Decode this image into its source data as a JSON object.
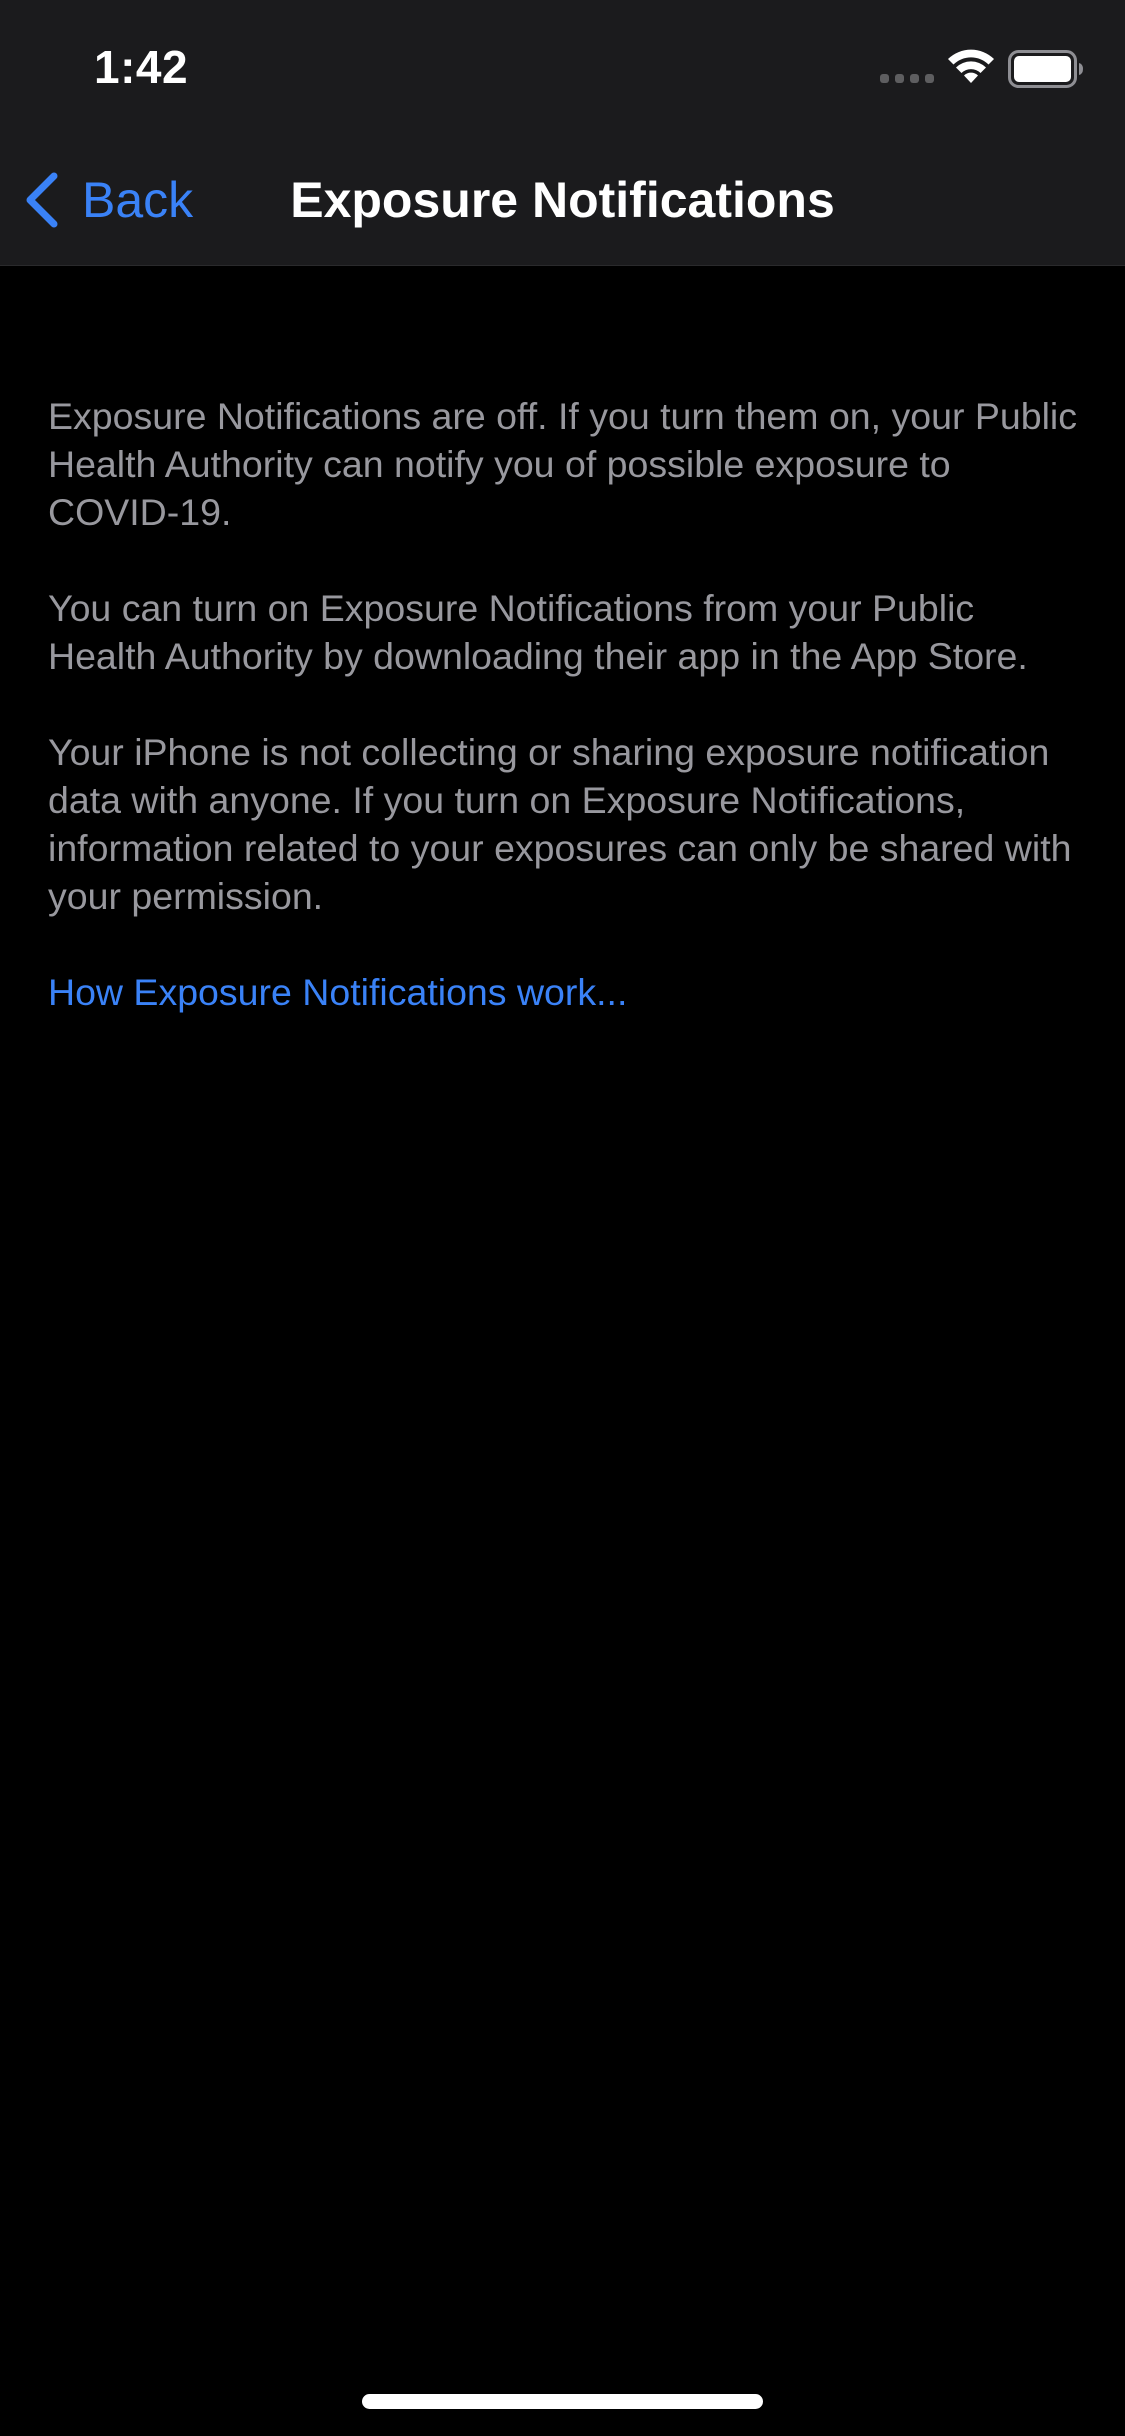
{
  "status_bar": {
    "time": "1:42",
    "icons": [
      "cellular-signal-icon",
      "wifi-icon",
      "battery-icon"
    ]
  },
  "nav": {
    "back_label": "Back",
    "back_icon": "chevron-left-icon",
    "title": "Exposure Notifications"
  },
  "content": {
    "paragraphs": [
      "Exposure Notifications are off. If you turn them on, your Public Health Authority can notify you of possible exposure to COVID-19.",
      "You can turn on Exposure Notifications from your Public Health Authority by downloading their app in the App Store.",
      "Your iPhone is not collecting or sharing exposure notification data with anyone. If you turn on Exposure Notifications, information related to your exposures can only be shared with your permission."
    ],
    "link_label": "How Exposure Notifications work..."
  },
  "colors": {
    "background": "#000000",
    "nav_background": "#1b1b1d",
    "accent": "#3a82f7",
    "body_text": "#98989e",
    "title_text": "#ffffff"
  }
}
